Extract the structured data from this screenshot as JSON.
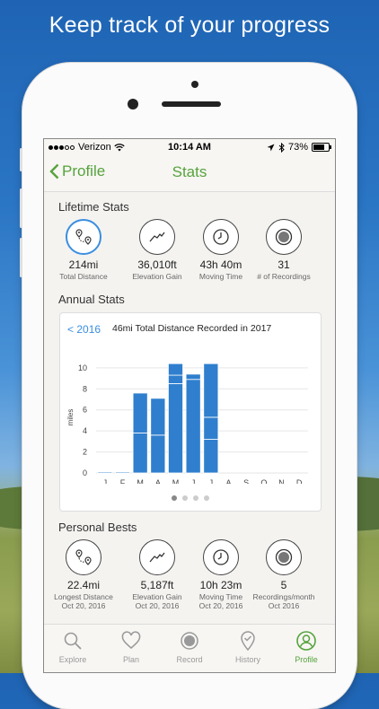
{
  "headline": "Keep track of your progress",
  "status_bar": {
    "carrier": "Verizon",
    "time": "10:14 AM",
    "battery": "73%"
  },
  "nav": {
    "back_label": "Profile",
    "title": "Stats"
  },
  "lifetime": {
    "title": "Lifetime Stats",
    "items": [
      {
        "value": "214mi",
        "label": "Total Distance",
        "icon": "route-icon"
      },
      {
        "value": "36,010ft",
        "label": "Elevation Gain",
        "icon": "elevation-icon"
      },
      {
        "value": "43h 40m",
        "label": "Moving Time",
        "icon": "clock-icon"
      },
      {
        "value": "31",
        "label": "# of Recordings",
        "icon": "record-icon"
      }
    ]
  },
  "annual": {
    "title": "Annual Stats",
    "prev_label": "< 2016",
    "card_title": "46mi Total Distance Recorded in 2017"
  },
  "chart_data": {
    "type": "bar",
    "title": "46mi Total Distance Recorded in 2017",
    "ylabel": "miles",
    "categories": [
      "J",
      "F",
      "M",
      "A",
      "M",
      "J",
      "J",
      "A",
      "S",
      "O",
      "N",
      "D"
    ],
    "values": [
      0.1,
      0.1,
      7.6,
      7.1,
      10.4,
      9.4,
      10.4,
      0,
      0,
      0,
      0,
      0
    ],
    "segments": [
      [
        0.1
      ],
      [
        0.1
      ],
      [
        3.8,
        3.8
      ],
      [
        3.6,
        3.5
      ],
      [
        8.5,
        0.8,
        1.1
      ],
      [
        8.9,
        0.5
      ],
      [
        3.2,
        2.1,
        5.1
      ],
      [],
      [],
      [],
      [],
      []
    ],
    "yticks": [
      0,
      2,
      4,
      6,
      8,
      10
    ],
    "ylim": [
      0,
      10.5
    ],
    "grid": true,
    "bar_color": "#2f7fce"
  },
  "personal": {
    "title": "Personal Bests",
    "items": [
      {
        "value": "22.4mi",
        "label": "Longest Distance",
        "date": "Oct 20, 2016",
        "icon": "route-icon"
      },
      {
        "value": "5,187ft",
        "label": "Elevation Gain",
        "date": "Oct 20, 2016",
        "icon": "elevation-icon"
      },
      {
        "value": "10h 23m",
        "label": "Moving Time",
        "date": "Oct 20, 2016",
        "icon": "clock-icon"
      },
      {
        "value": "5",
        "label": "Recordings/month",
        "date": "Oct 2016",
        "icon": "record-icon"
      }
    ]
  },
  "tabs": [
    {
      "label": "Explore",
      "icon": "search-icon"
    },
    {
      "label": "Plan",
      "icon": "heart-icon"
    },
    {
      "label": "Record",
      "icon": "record-icon"
    },
    {
      "label": "History",
      "icon": "checkmark-pin-icon"
    },
    {
      "label": "Profile",
      "icon": "profile-icon",
      "selected": true
    }
  ],
  "colors": {
    "accent_green": "#56a33c",
    "accent_blue": "#3b8ee0"
  }
}
